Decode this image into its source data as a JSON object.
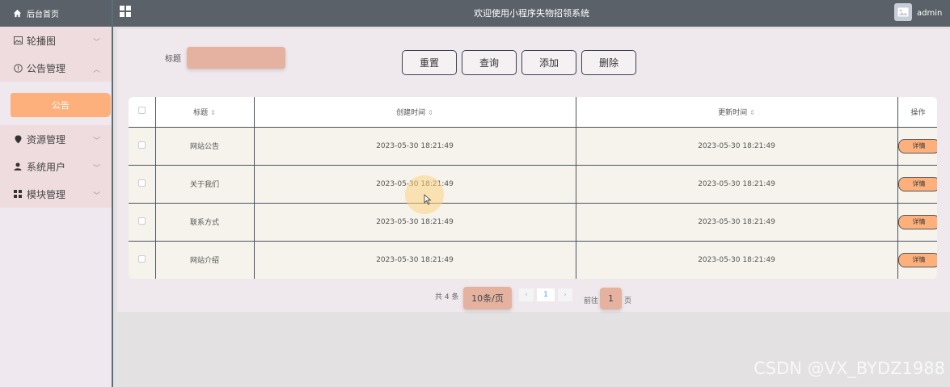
{
  "sidebar": {
    "home_label": "后台首页",
    "items": [
      {
        "label": "轮播图",
        "icon": "image-icon",
        "expanded": false
      },
      {
        "label": "公告管理",
        "icon": "info-circle-icon",
        "expanded": true,
        "children": [
          {
            "label": "公告",
            "active": true
          }
        ]
      },
      {
        "label": "资源管理",
        "icon": "location-icon",
        "expanded": false
      },
      {
        "label": "系统用户",
        "icon": "user-icon",
        "expanded": false
      },
      {
        "label": "模块管理",
        "icon": "grid-icon",
        "expanded": false
      }
    ]
  },
  "header": {
    "title": "欢迎使用小程序失物招领系统",
    "username": "admin"
  },
  "search": {
    "label": "标题",
    "value": "",
    "buttons": {
      "reset": "重置",
      "query": "查询",
      "add": "添加",
      "delete": "删除"
    }
  },
  "table": {
    "columns": [
      "标题",
      "创建时间",
      "更新时间",
      "操作"
    ],
    "rows": [
      {
        "title": "网站公告",
        "created": "2023-05-30 18:21:49",
        "updated": "2023-05-30 18:21:49",
        "action": "详情"
      },
      {
        "title": "关于我们",
        "created": "2023-05-30 18:21:49",
        "updated": "2023-05-30 18:21:49",
        "action": "详情"
      },
      {
        "title": "联系方式",
        "created": "2023-05-30 18:21:49",
        "updated": "2023-05-30 18:21:49",
        "action": "详情"
      },
      {
        "title": "网站介绍",
        "created": "2023-05-30 18:21:49",
        "updated": "2023-05-30 18:21:49",
        "action": "详情"
      }
    ]
  },
  "pagination": {
    "total_text": "共 4 条",
    "page_size": "10条/页",
    "prev": "‹",
    "current": "1",
    "next": "›",
    "goto_label": "前往",
    "goto_value": "1",
    "page_word": "页"
  },
  "watermark": "CSDN @VX_BYDZ1988",
  "colors": {
    "accent": "#fdb07c",
    "header": "#5b6168",
    "input": "#e5b2a0"
  }
}
